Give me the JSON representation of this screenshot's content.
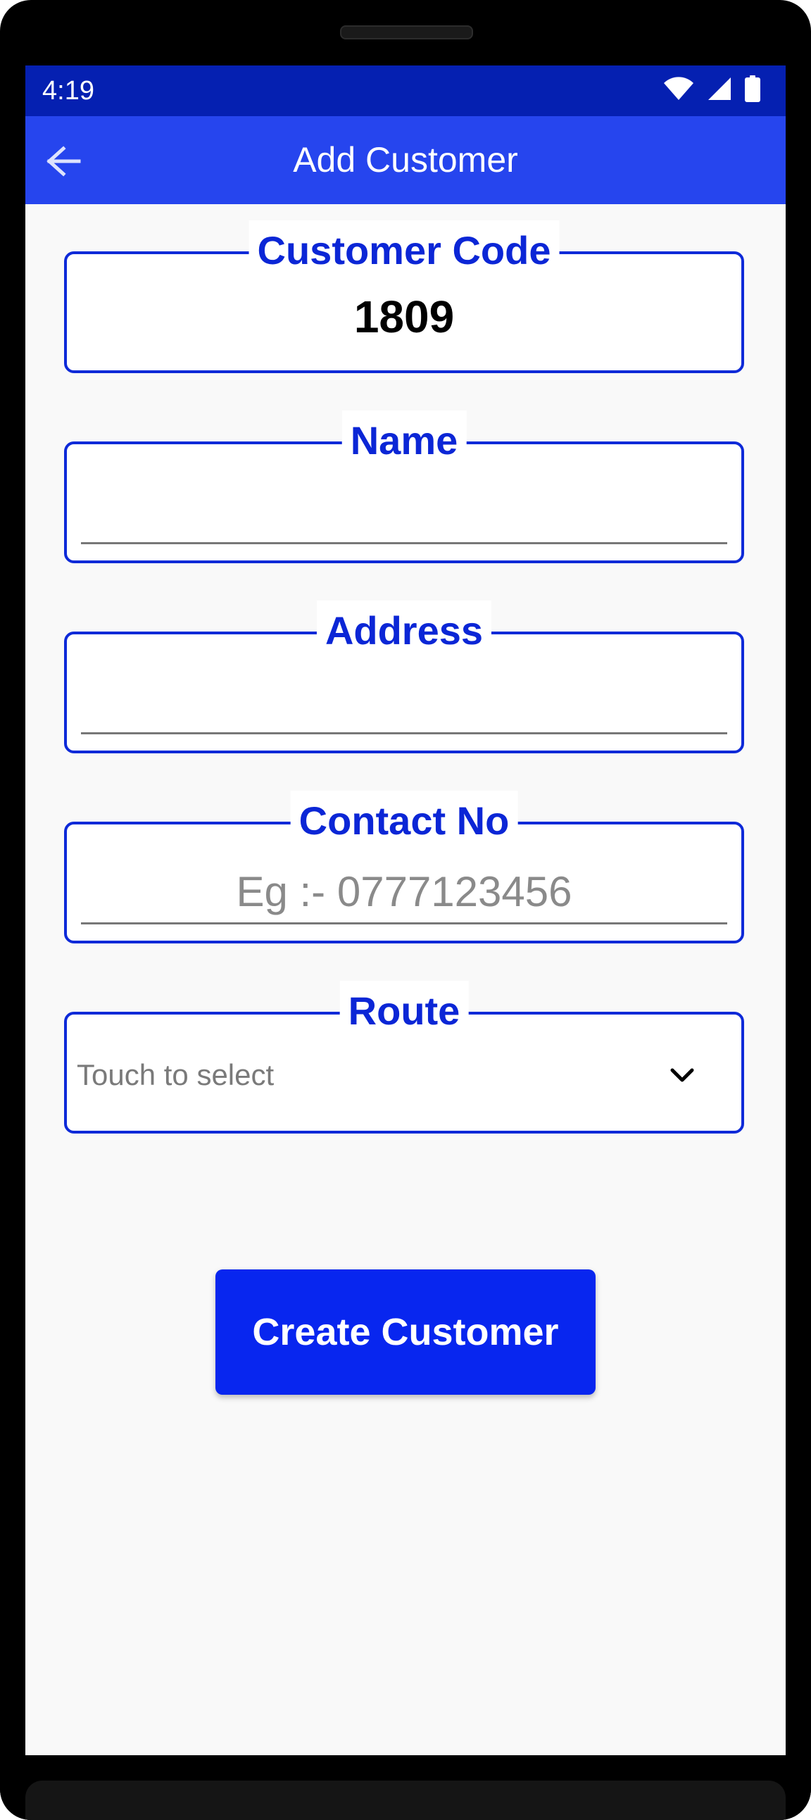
{
  "status_bar": {
    "time": "4:19",
    "icons": [
      "wifi-icon",
      "cellular-signal-icon",
      "battery-icon"
    ],
    "background": "#0520b1"
  },
  "app_bar": {
    "title": "Add Customer",
    "back_icon": "arrow-left-icon",
    "background": "#2645ee"
  },
  "form": {
    "customer_code": {
      "label": "Customer Code",
      "value": "1809"
    },
    "name": {
      "label": "Name",
      "value": "",
      "placeholder": ""
    },
    "address": {
      "label": "Address",
      "value": "",
      "placeholder": ""
    },
    "contact_no": {
      "label": "Contact No",
      "value": "",
      "placeholder": "Eg :- 0777123456"
    },
    "route": {
      "label": "Route",
      "selected": "Touch to select",
      "icon": "chevron-down-icon"
    }
  },
  "actions": {
    "create_label": "Create Customer"
  },
  "colors": {
    "accent": "#0b26d6",
    "button": "#0826ef",
    "screen_background": "#f9f9f9"
  }
}
